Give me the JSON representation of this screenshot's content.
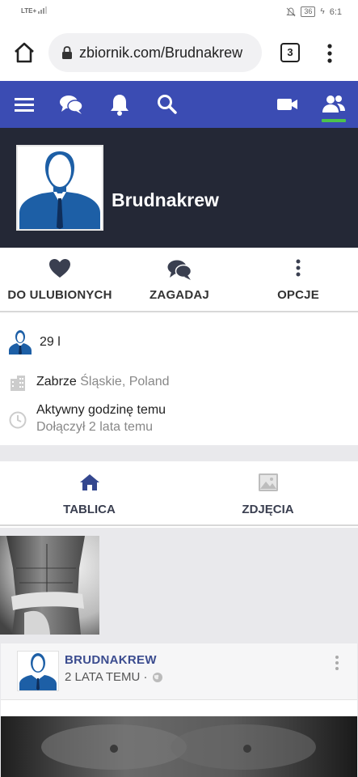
{
  "status_bar": {
    "network": "LTE+",
    "battery": "36",
    "time": "6:1"
  },
  "browser": {
    "url": "zbiornik.com/Brudnakrew",
    "tab_count": "3"
  },
  "site_nav": {
    "icons": [
      "menu-icon",
      "chat-icon",
      "bell-icon",
      "search-icon",
      "video-icon",
      "people-icon"
    ],
    "accent_color": "#3b4cb3",
    "active_indicator_color": "#4cc34c"
  },
  "profile": {
    "name": "Brudnakrew"
  },
  "actions": [
    {
      "label": "DO ULUBIONYCH",
      "icon": "heart-icon"
    },
    {
      "label": "ZAGADAJ",
      "icon": "chat-icon"
    },
    {
      "label": "OPCJE",
      "icon": "more-vertical-icon"
    }
  ],
  "info": {
    "age": "29 l",
    "city": "Zabrze",
    "region": "Śląskie, Poland",
    "active": "Aktywny godzinę temu",
    "joined": "Dołączył 2 lata temu"
  },
  "profile_tabs": [
    {
      "label": "TABLICA",
      "icon": "home-icon"
    },
    {
      "label": "ZDJĘCIA",
      "icon": "image-icon"
    }
  ],
  "post": {
    "author": "BRUDNAKREW",
    "time": "2 LATA TEMU ·"
  }
}
